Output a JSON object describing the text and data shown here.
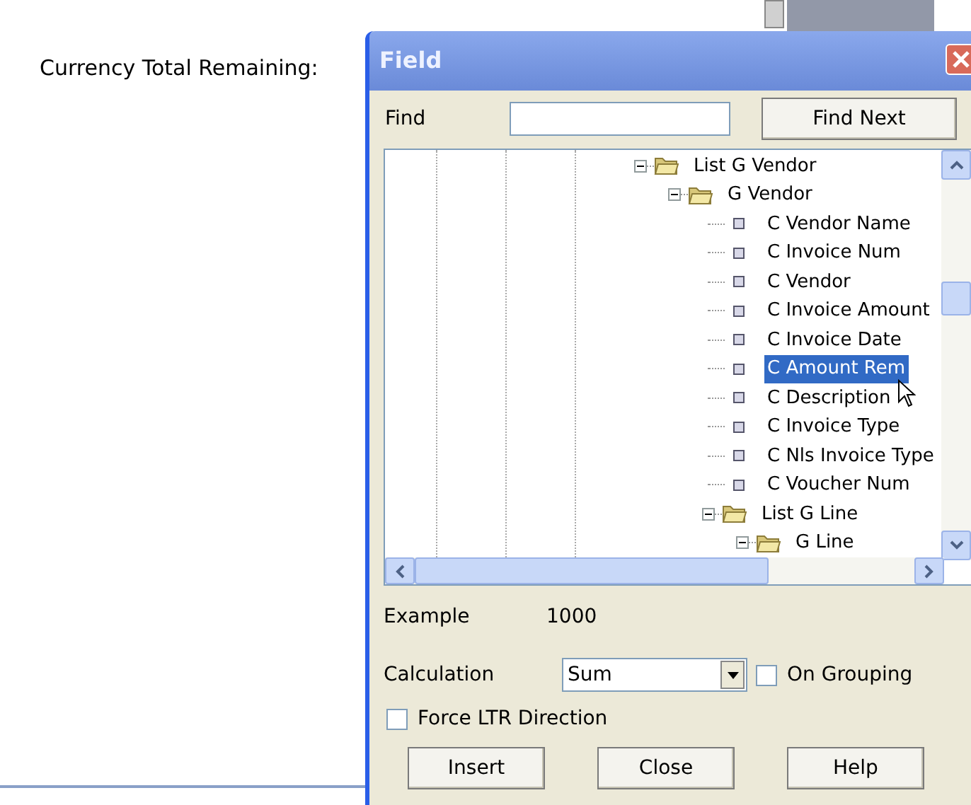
{
  "page": {
    "label": "Currency Total Remaining:"
  },
  "dialog": {
    "title": "Field",
    "find": {
      "label": "Find"
    },
    "find_next_button": "Find Next",
    "tree": [
      {
        "label": "List G Vendor",
        "kind": "folder",
        "expanded": true,
        "selected": false,
        "children": [
          {
            "label": "G Vendor",
            "kind": "folder",
            "expanded": true,
            "selected": false,
            "children": [
              {
                "label": "C Vendor Name",
                "kind": "field",
                "selected": false
              },
              {
                "label": "C Invoice Num",
                "kind": "field",
                "selected": false
              },
              {
                "label": "C Vendor",
                "kind": "field",
                "selected": false
              },
              {
                "label": "C Invoice Amount",
                "kind": "field",
                "selected": false
              },
              {
                "label": "C Invoice Date",
                "kind": "field",
                "selected": false
              },
              {
                "label": "C Amount Rem",
                "kind": "field",
                "selected": true
              },
              {
                "label": "C Description",
                "kind": "field",
                "selected": false
              },
              {
                "label": "C Invoice Type",
                "kind": "field",
                "selected": false
              },
              {
                "label": "C Nls Invoice Type",
                "kind": "field",
                "selected": false
              },
              {
                "label": "C Voucher Num",
                "kind": "field",
                "selected": false
              },
              {
                "label": "List G Line",
                "kind": "folder",
                "expanded": true,
                "selected": false,
                "children": [
                  {
                    "label": "G Line",
                    "kind": "folder",
                    "expanded": true,
                    "selected": false
                  }
                ]
              }
            ]
          }
        ]
      }
    ],
    "example": {
      "label": "Example",
      "value": "1000"
    },
    "calculation": {
      "label": "Calculation",
      "value": "Sum"
    },
    "on_grouping": {
      "label": "On Grouping",
      "checked": false
    },
    "force_ltr": {
      "label": "Force LTR Direction",
      "checked": false
    },
    "buttons": [
      "Insert",
      "Close",
      "Help"
    ]
  }
}
